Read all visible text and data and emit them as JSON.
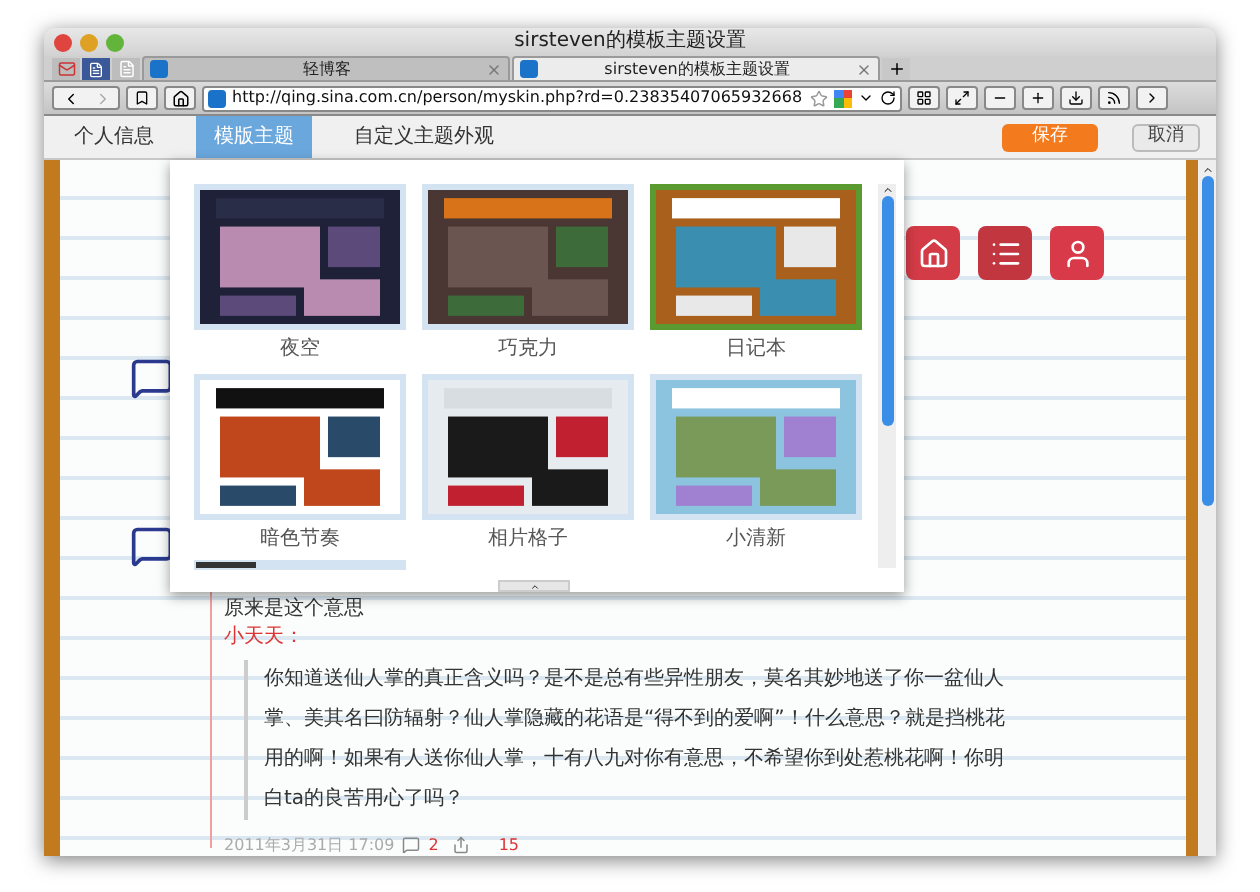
{
  "window": {
    "title": "sirsteven的模板主题设置"
  },
  "browser_tabs": [
    {
      "label": "轻博客",
      "selected": false
    },
    {
      "label": "sirsteven的模板主题设置",
      "selected": true
    }
  ],
  "address_bar": {
    "url": "http://qing.sina.com.cn/person/myskin.php?rd=0.23835407065932668"
  },
  "settings_tabs": [
    {
      "label": "个人信息",
      "selected": false
    },
    {
      "label": "模版主题",
      "selected": true
    },
    {
      "label": "自定义主题外观",
      "selected": false
    }
  ],
  "buttons": {
    "save": "保存",
    "cancel": "取消"
  },
  "themes": [
    {
      "name": "夜空",
      "selected": false
    },
    {
      "name": "巧克力",
      "selected": false
    },
    {
      "name": "日记本",
      "selected": true
    },
    {
      "name": "暗色节奏",
      "selected": false
    },
    {
      "name": "相片格子",
      "selected": false
    },
    {
      "name": "小清新",
      "selected": false
    }
  ],
  "post": {
    "text": "原来是这个意思",
    "author": "小天天：",
    "quote": "你知道送仙人掌的真正含义吗？是不是总有些异性朋友，莫名其妙地送了你一盆仙人掌、美其名曰防辐射？仙人掌隐藏的花语是“得不到的爱啊”！什么意思？就是挡桃花用的啊！如果有人送你仙人掌，十有八九对你有意思，不希望你到处惹桃花啊！你明白ta的良苦用心了吗？",
    "date": "2011年3月31日 17:09",
    "comments": "2",
    "likes": "15"
  }
}
